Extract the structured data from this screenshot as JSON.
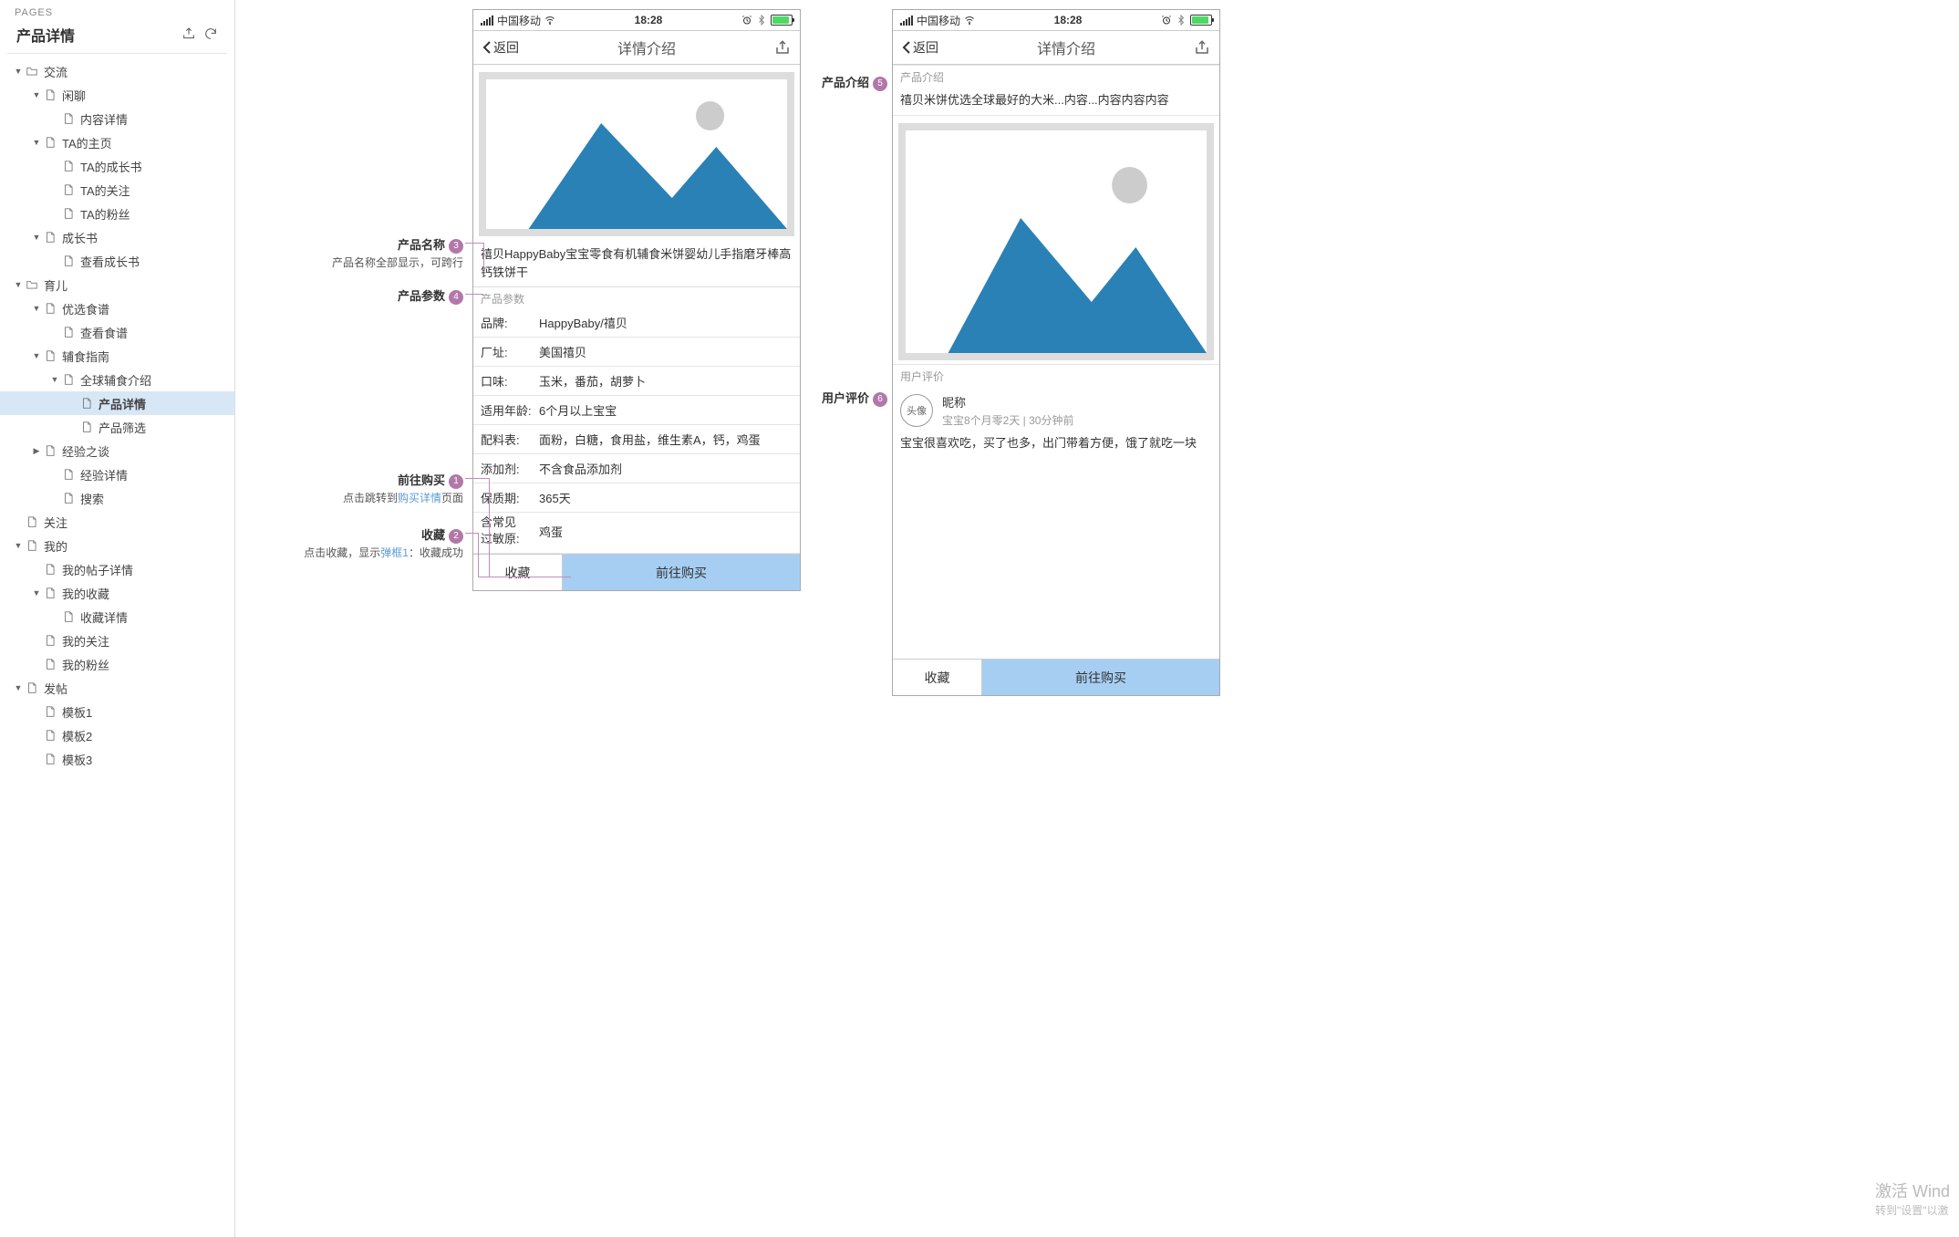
{
  "sidebar": {
    "pages_label": "PAGES",
    "page_title": "产品详情",
    "tree": [
      {
        "depth": 0,
        "caret": "down",
        "icon": "folder",
        "label": "交流"
      },
      {
        "depth": 1,
        "caret": "down",
        "icon": "page",
        "label": "闲聊"
      },
      {
        "depth": 2,
        "caret": "none",
        "icon": "page",
        "label": "内容详情"
      },
      {
        "depth": 1,
        "caret": "down",
        "icon": "page",
        "label": "TA的主页"
      },
      {
        "depth": 2,
        "caret": "none",
        "icon": "page",
        "label": "TA的成长书"
      },
      {
        "depth": 2,
        "caret": "none",
        "icon": "page",
        "label": "TA的关注"
      },
      {
        "depth": 2,
        "caret": "none",
        "icon": "page",
        "label": "TA的粉丝"
      },
      {
        "depth": 1,
        "caret": "down",
        "icon": "page",
        "label": "成长书"
      },
      {
        "depth": 2,
        "caret": "none",
        "icon": "page",
        "label": "查看成长书"
      },
      {
        "depth": 0,
        "caret": "down",
        "icon": "folder",
        "label": "育儿"
      },
      {
        "depth": 1,
        "caret": "down",
        "icon": "page",
        "label": "优选食谱"
      },
      {
        "depth": 2,
        "caret": "none",
        "icon": "page",
        "label": "查看食谱"
      },
      {
        "depth": 1,
        "caret": "down",
        "icon": "page",
        "label": "辅食指南"
      },
      {
        "depth": 2,
        "caret": "down",
        "icon": "page",
        "label": "全球辅食介绍"
      },
      {
        "depth": 3,
        "caret": "none",
        "icon": "page",
        "label": "产品详情",
        "selected": true
      },
      {
        "depth": 3,
        "caret": "none",
        "icon": "page",
        "label": "产品筛选"
      },
      {
        "depth": 1,
        "caret": "right",
        "icon": "page",
        "label": "经验之谈"
      },
      {
        "depth": 2,
        "caret": "none",
        "icon": "page",
        "label": "经验详情"
      },
      {
        "depth": 2,
        "caret": "none",
        "icon": "page",
        "label": "搜索"
      },
      {
        "depth": 0,
        "caret": "none",
        "icon": "page",
        "label": "关注"
      },
      {
        "depth": 0,
        "caret": "down",
        "icon": "page",
        "label": "我的"
      },
      {
        "depth": 1,
        "caret": "none",
        "icon": "page",
        "label": "我的帖子详情"
      },
      {
        "depth": 1,
        "caret": "down",
        "icon": "page",
        "label": "我的收藏"
      },
      {
        "depth": 2,
        "caret": "none",
        "icon": "page",
        "label": "收藏详情"
      },
      {
        "depth": 1,
        "caret": "none",
        "icon": "page",
        "label": "我的关注"
      },
      {
        "depth": 1,
        "caret": "none",
        "icon": "page",
        "label": "我的粉丝"
      },
      {
        "depth": 0,
        "caret": "down",
        "icon": "page",
        "label": "发帖"
      },
      {
        "depth": 1,
        "caret": "none",
        "icon": "page",
        "label": "模板1"
      },
      {
        "depth": 1,
        "caret": "none",
        "icon": "page",
        "label": "模板2"
      },
      {
        "depth": 1,
        "caret": "none",
        "icon": "page",
        "label": "模板3"
      }
    ]
  },
  "statusbar": {
    "carrier": "中国移动",
    "time": "18:28"
  },
  "nav": {
    "back": "返回",
    "title": "详情介绍"
  },
  "phone1": {
    "product_name": "禧贝HappyBaby宝宝零食有机辅食米饼婴幼儿手指磨牙棒高钙铁饼干",
    "section_params": "产品参数",
    "params": [
      {
        "k": "品牌:",
        "v": "HappyBaby/禧贝"
      },
      {
        "k": "厂址:",
        "v": "美国禧贝"
      },
      {
        "k": "口味:",
        "v": "玉米，番茄，胡萝卜"
      },
      {
        "k": "适用年龄:",
        "v": "6个月以上宝宝"
      },
      {
        "k": "配料表:",
        "v": "面粉，白糖，食用盐，维生素A，钙，鸡蛋"
      },
      {
        "k": "添加剂:",
        "v": "不含食品添加剂"
      },
      {
        "k": "保质期:",
        "v": "365天"
      }
    ],
    "allergen_k1": "含常见",
    "allergen_k2": "过敏原:",
    "allergen_v": "鸡蛋",
    "btn_fav": "收藏",
    "btn_buy": "前往购买"
  },
  "phone2": {
    "section_intro": "产品介绍",
    "intro_text": "禧贝米饼优选全球最好的大米...内容...内容内容内容",
    "section_review": "用户评价",
    "avatar": "头像",
    "nickname": "昵称",
    "meta": "宝宝8个月零2天 | 30分钟前",
    "review_body": "宝宝很喜欢吃，买了也多，出门带着方便，饿了就吃一块",
    "btn_fav": "收藏",
    "btn_buy": "前往购买"
  },
  "annotations": {
    "a3": {
      "title": "产品名称",
      "num": "3",
      "desc": "产品名称全部显示，可跨行"
    },
    "a4": {
      "title": "产品参数",
      "num": "4"
    },
    "a1": {
      "title": "前往购买",
      "num": "1",
      "desc_pre": "点击跳转到",
      "link": "购买详情",
      "desc_post": "页面"
    },
    "a2": {
      "title": "收藏",
      "num": "2",
      "desc_pre": "点击收藏，显示",
      "link": "弹框1",
      "desc_post": "：收藏成功"
    },
    "a5": {
      "title": "产品介绍",
      "num": "5"
    },
    "a6": {
      "title": "用户评价",
      "num": "6"
    }
  },
  "watermark": {
    "line1": "激活 Wind",
    "line2": "转到\"设置\"以激"
  }
}
